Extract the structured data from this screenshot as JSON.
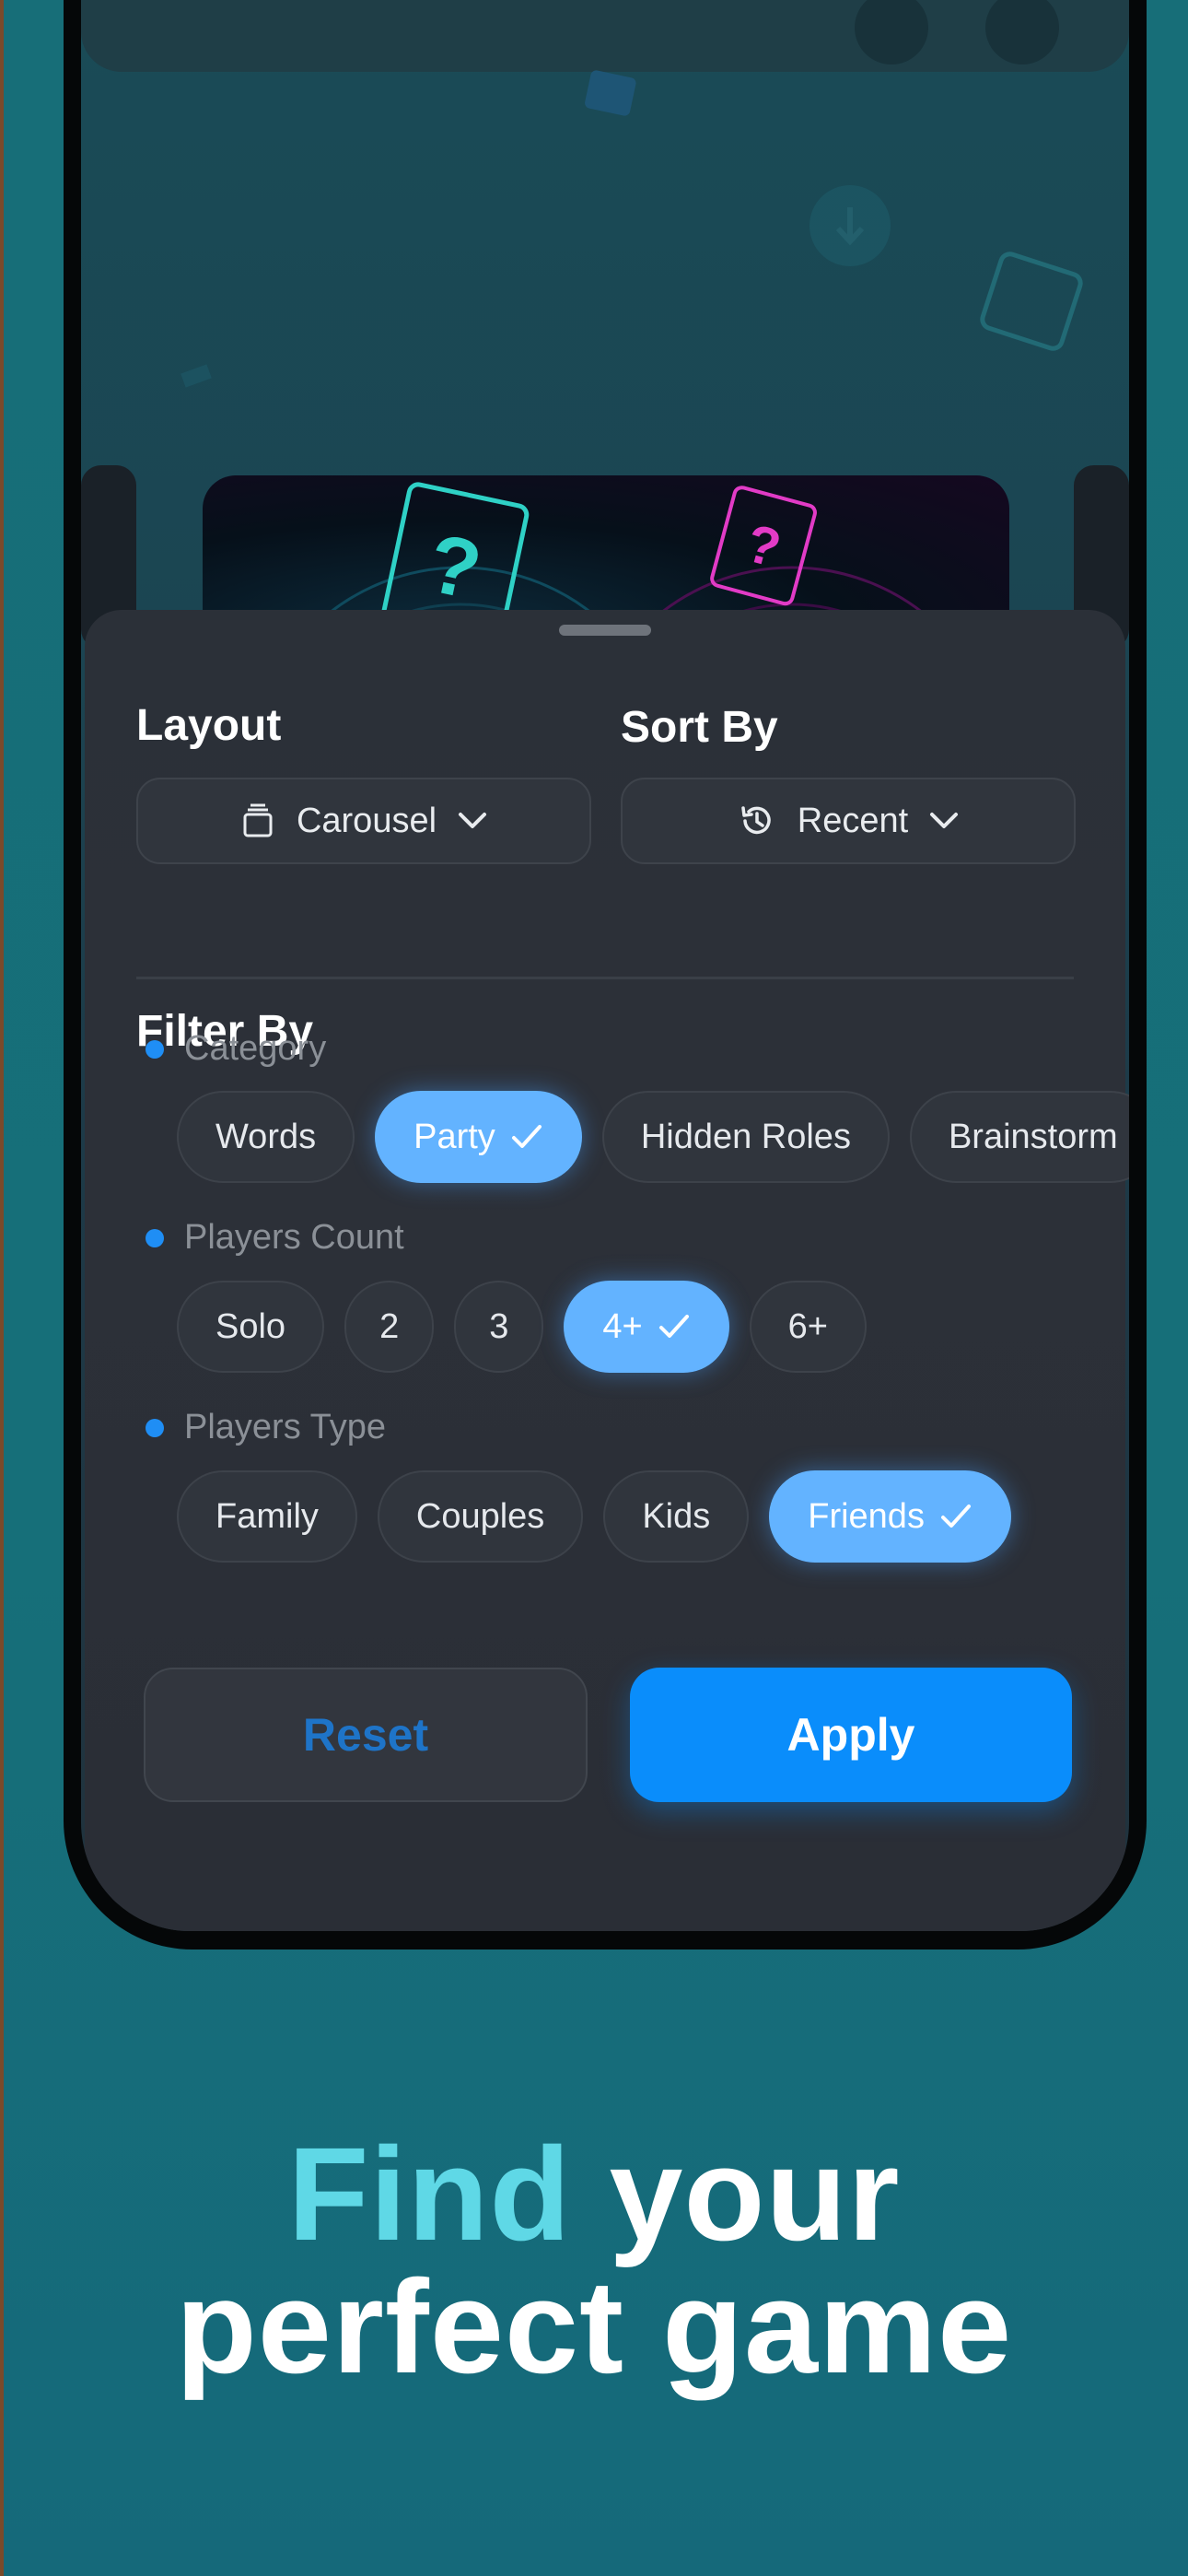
{
  "sheet": {
    "layout": {
      "title": "Layout",
      "value": "Carousel",
      "icon": "stack-icon"
    },
    "sort": {
      "title": "Sort By",
      "value": "Recent",
      "icon": "history-icon"
    },
    "filter_title": "Filter By",
    "groups": [
      {
        "label": "Category",
        "chips": [
          {
            "label": "Words",
            "selected": false
          },
          {
            "label": "Party",
            "selected": true
          },
          {
            "label": "Hidden Roles",
            "selected": false
          },
          {
            "label": "Brainstorm",
            "selected": false
          }
        ]
      },
      {
        "label": "Players Count",
        "chips": [
          {
            "label": "Solo",
            "selected": false
          },
          {
            "label": "2",
            "selected": false
          },
          {
            "label": "3",
            "selected": false
          },
          {
            "label": "4+",
            "selected": true
          },
          {
            "label": "6+",
            "selected": false
          }
        ]
      },
      {
        "label": "Players Type",
        "chips": [
          {
            "label": "Family",
            "selected": false
          },
          {
            "label": "Couples",
            "selected": false
          },
          {
            "label": "Kids",
            "selected": false
          },
          {
            "label": "Friends",
            "selected": true
          }
        ]
      }
    ],
    "reset_label": "Reset",
    "apply_label": "Apply"
  },
  "headline": {
    "accent": "Find",
    "rest_line1": "your",
    "line2": "perfect game"
  },
  "colors": {
    "accent_blue": "#0a8dfb",
    "selected_chip": "#63b3ff",
    "headline_accent": "#5fd8e6",
    "background": "#176e78"
  }
}
